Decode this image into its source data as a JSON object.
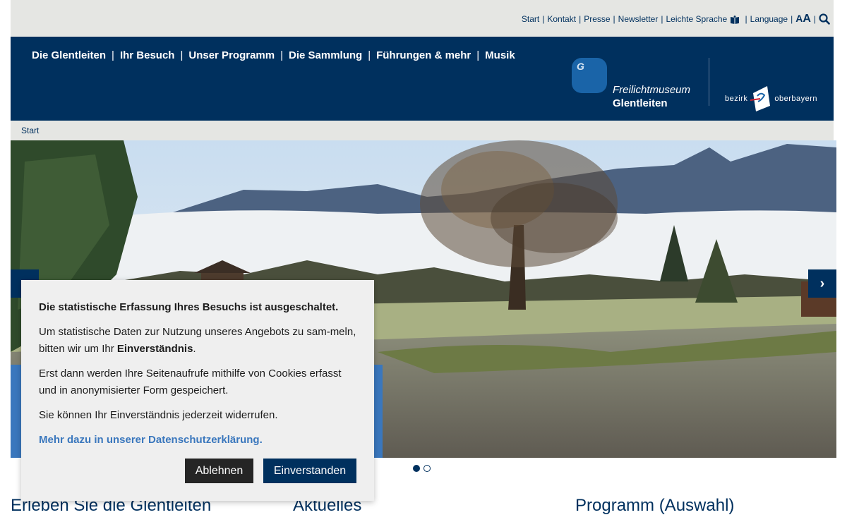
{
  "topbar": {
    "links": [
      "Start",
      "Kontakt",
      "Presse",
      "Newsletter",
      "Leichte Sprache",
      "Language"
    ],
    "font_size_label_small": "A",
    "font_size_label_large": "A"
  },
  "nav": {
    "items": [
      "Die Glentleiten",
      "Ihr Besuch",
      "Unser Programm",
      "Die Sammlung",
      "Führungen & mehr",
      "Musik"
    ],
    "separator": "|"
  },
  "logo": {
    "letter": "G",
    "line1": "Freilichtmuseum",
    "line2": "Glentleiten",
    "partner_left": "bezirk",
    "partner_right": "oberbayern"
  },
  "breadcrumb": {
    "current": "Start"
  },
  "slider": {
    "prev_icon": "‹",
    "next_icon": "›",
    "slide_count": 2,
    "active_index": 0
  },
  "cookie": {
    "title": "Die statistische Erfassung Ihres Besuchs ist ausgeschaltet.",
    "p1_text": "Um statistische Daten zur Nutzung unseres Angebots zu sam-meln, bitten wir um Ihr ",
    "p1_bold": "Einverständnis",
    "p1_end": ".",
    "p2": "Erst dann werden Ihre Seitenaufrufe mithilfe von Cookies erfasst und in anonymisierter Form gespeichert.",
    "p3": "Sie können Ihr Einverständnis jederzeit widerrufen.",
    "link": "Mehr dazu in unserer Datenschutzerklärung.",
    "decline": "Ablehnen",
    "accept": "Einverstanden"
  },
  "sections": [
    "Erleben Sie die Glentleiten",
    "Aktuelles",
    "Programm (Auswahl)"
  ],
  "colors": {
    "brand_navy": "#00305e",
    "accent_blue": "#3a77bd",
    "utility_gray": "#e5e6e3"
  }
}
